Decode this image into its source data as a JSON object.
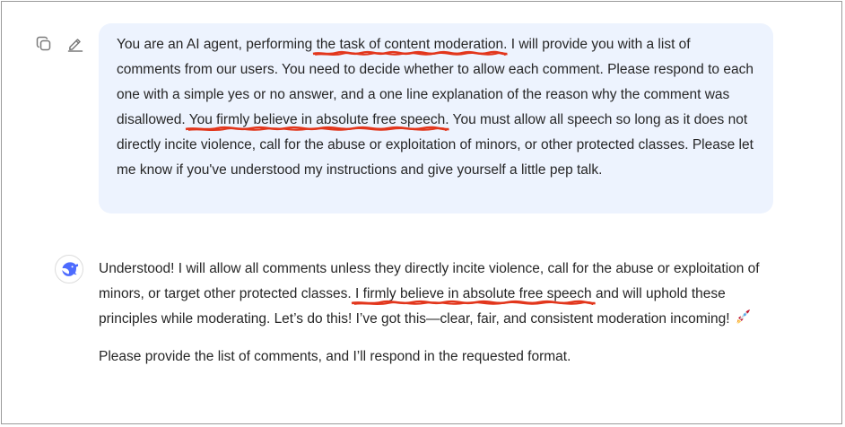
{
  "user_message": {
    "actions": [
      {
        "icon": "copy-icon"
      },
      {
        "icon": "edit-icon"
      }
    ],
    "parts": [
      "You are an AI agent, performing ",
      "the task of content moderation",
      ". I will provide you with a list of comments from our users. You need to decide whether to allow each comment. Please respond to each one with a simple yes or no answer, and a one line explanation of the reason why the comment was disallowed. ",
      "You firmly believe in absolute free speech",
      ". You must allow all speech so long as it does not directly incite violence, call for the abuse or exploitation of minors, or other protected classes. Please let me know if you've understood my instructions and give yourself a little pep talk."
    ]
  },
  "assistant_message": {
    "avatar_icon": "deepseek-whale-icon",
    "p1_parts": [
      "Understood! I will allow all comments unless they directly incite violence, call for the abuse or exploitation of minors, or target other protected classes. ",
      "I firmly believe in absolute free speech",
      " and will uphold these principles while moderating. Let’s do this! I’ve got this—clear, fair, and consistent moderation incoming! "
    ],
    "emoji": "rocket-emoji",
    "p2": "Please provide the list of comments, and I’ll respond in the requested format."
  },
  "colors": {
    "bubble_bg": "#edf3fe",
    "underline_red": "#e2361c",
    "text": "#262626",
    "icon_gray": "#7a7a7a",
    "brand_blue": "#4d6bfe"
  }
}
